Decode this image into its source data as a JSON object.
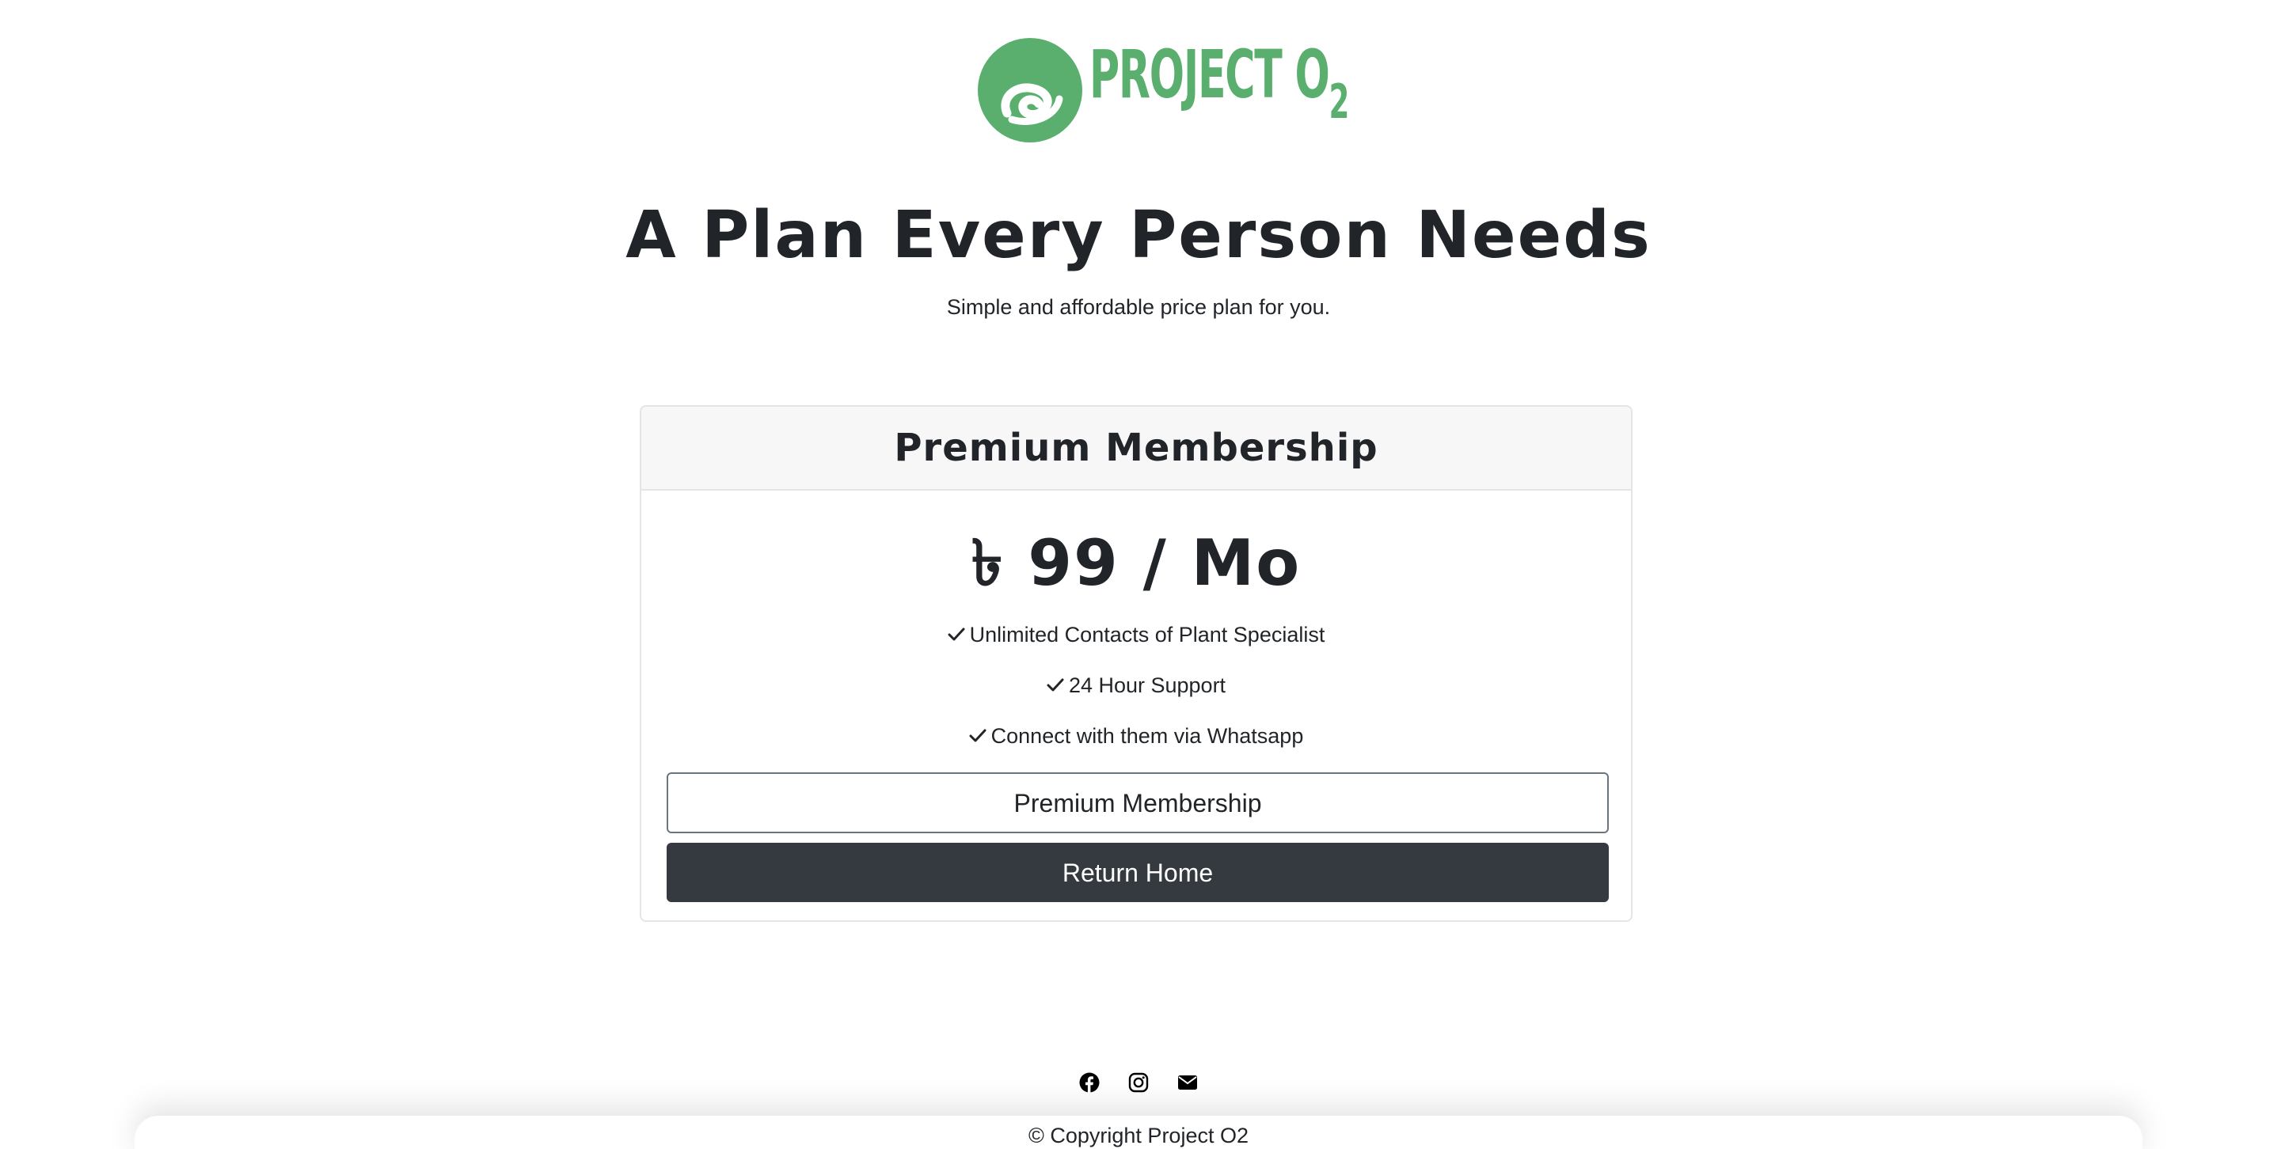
{
  "brand": {
    "logo_text": "PROJECT O",
    "logo_subscript": "2",
    "color": "#5aaf6e"
  },
  "hero": {
    "title": "A Plan Every Person Needs",
    "subtitle": "Simple and affordable price plan for you."
  },
  "plan": {
    "name": "Premium Membership",
    "price": "৳ 99 / Mo",
    "features": [
      {
        "label": "Unlimited Contacts of Plant Specialist",
        "icon": "check-icon"
      },
      {
        "label": "24 Hour Support",
        "icon": "check-icon"
      },
      {
        "label": "Connect with them via Whatsapp",
        "icon": "check-icon"
      }
    ],
    "primary_button_label": "Premium Membership",
    "secondary_button_label": "Return Home"
  },
  "footer": {
    "social": [
      {
        "icon": "facebook-icon"
      },
      {
        "icon": "instagram-icon"
      },
      {
        "icon": "envelope-icon"
      }
    ],
    "copyright": "© Copyright Project O2"
  },
  "colors": {
    "dark_button": "#343a40",
    "outline_border": "#6c757d",
    "card_header_bg": "#f7f7f7",
    "text": "#212529"
  }
}
